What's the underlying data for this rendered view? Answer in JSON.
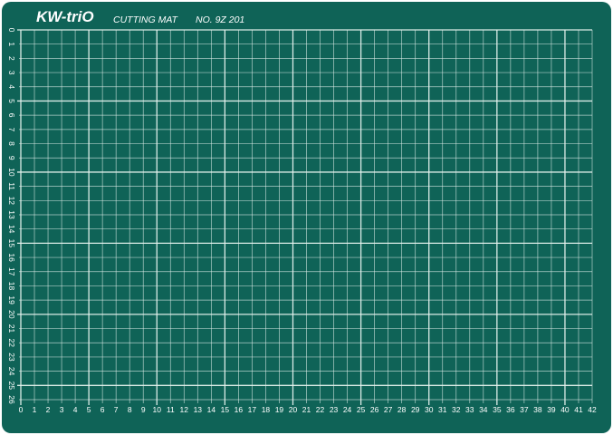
{
  "mat": {
    "brand": "KW-triO",
    "label": "CUTTING MAT",
    "model": "NO. 9Z 201",
    "background_color": "#0f6357",
    "grid_color": "#e6f2ee"
  },
  "ruler": {
    "horizontal_numbers": [
      "0",
      "1",
      "2",
      "3",
      "4",
      "5",
      "6",
      "7",
      "8",
      "9",
      "10",
      "11",
      "12",
      "13",
      "14",
      "15",
      "16",
      "17",
      "18",
      "19",
      "20",
      "21",
      "22",
      "23",
      "24",
      "25",
      "26",
      "27",
      "28",
      "29",
      "30",
      "31",
      "32",
      "33",
      "34",
      "35",
      "36",
      "37",
      "38",
      "39",
      "40",
      "41",
      "42"
    ],
    "vertical_numbers": [
      "0",
      "1",
      "2",
      "3",
      "4",
      "5",
      "6",
      "7",
      "8",
      "9",
      "10",
      "11",
      "12",
      "13",
      "14",
      "15",
      "16",
      "17",
      "18",
      "19",
      "20",
      "21",
      "22",
      "23",
      "24",
      "25",
      "26"
    ],
    "major_every": 5
  }
}
